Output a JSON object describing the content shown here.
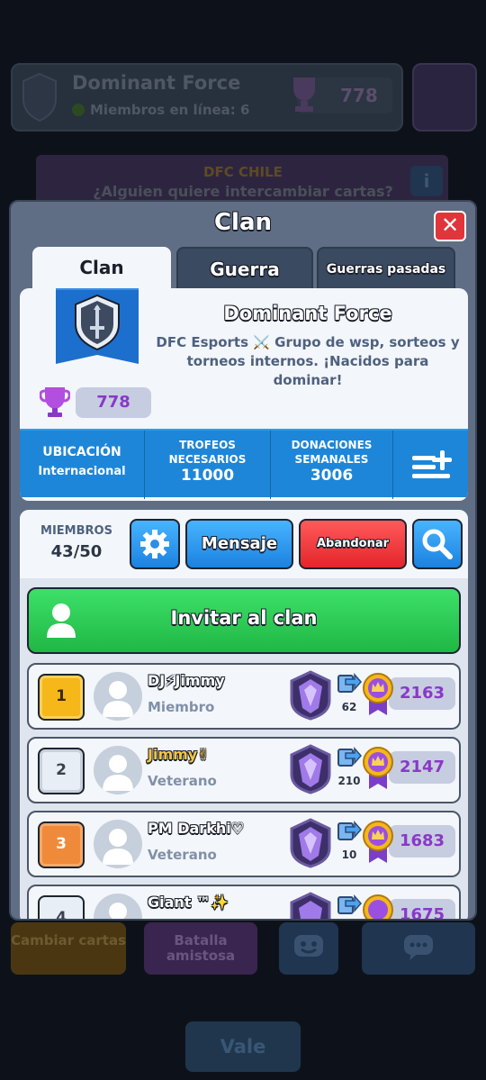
{
  "background": {
    "clan_name": "Dominant Force",
    "online_label": "Miembros en línea: 6",
    "trophies": "778",
    "banner_title": "DFC CHILE",
    "banner_text": "¿Alguien quiere intercambiar cartas?",
    "info_glyph": "i",
    "bottom_buttons": [
      {
        "label": "Cambiar cartas"
      },
      {
        "label": "Batalla amistosa"
      }
    ],
    "vale_label": "Vale"
  },
  "modal": {
    "title": "Clan",
    "close_glyph": "✕",
    "tabs": [
      {
        "label": "Clan"
      },
      {
        "label": "Guerra"
      },
      {
        "label": "Guerras pasadas"
      }
    ]
  },
  "clan": {
    "name": "Dominant Force",
    "description": "DFC Esports ⚔️ Grupo de wsp, sorteos y torneos internos. ¡Nacidos para dominar!",
    "trophies": "778",
    "stats": {
      "location_label": "UBICACIÓN",
      "location_value": "Internacional",
      "required_label_1": "TROFEOS",
      "required_label_2": "NECESARIOS",
      "required_value": "11000",
      "donations_label_1": "DONACIONES",
      "donations_label_2": "SEMANALES",
      "donations_value": "3006"
    }
  },
  "members": {
    "label": "MIEMBROS",
    "count": "43/50",
    "message_label": "Mensaje",
    "leave_label": "Abandonar",
    "invite_label": "Invitar al clan",
    "list": [
      {
        "rank": "1",
        "name": "DJ⚡Jimmy",
        "role": "Miembro",
        "donations": "62",
        "trophies": "2163"
      },
      {
        "rank": "2",
        "name": "Jimmy✌",
        "role": "Veterano",
        "donations": "210",
        "trophies": "2147"
      },
      {
        "rank": "3",
        "name": "PM Darkhi♡",
        "role": "Veterano",
        "donations": "10",
        "trophies": "1683"
      },
      {
        "rank": "4",
        "name": "Giant ™✨",
        "role": "",
        "donations": "",
        "trophies": "1675"
      }
    ]
  },
  "colors": {
    "accent_blue": "#1e86d8",
    "accent_green": "#1fb843",
    "accent_red": "#e3262b",
    "trophy_purple": "#8a38c8"
  }
}
